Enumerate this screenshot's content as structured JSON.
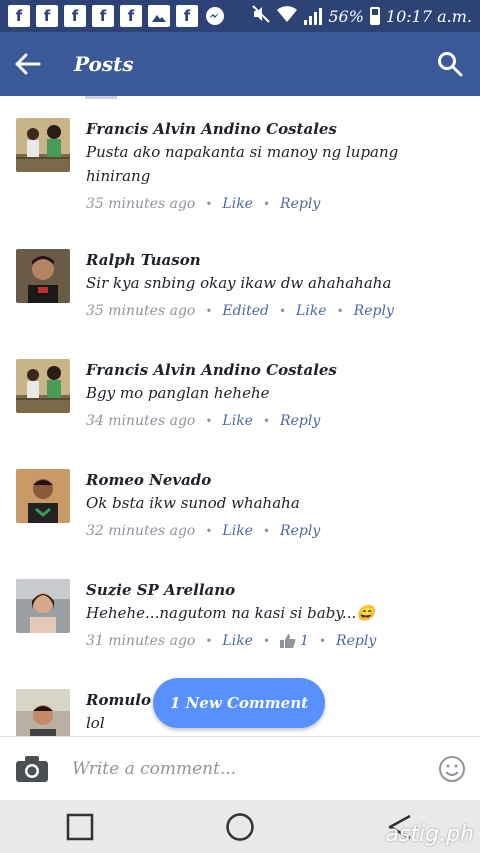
{
  "status_bar": {
    "battery": "56%",
    "time": "10:17 a.m."
  },
  "app_bar": {
    "title": "Posts"
  },
  "comments": [
    {
      "name": "Francis Alvin Andino Costales",
      "text": "Pusta ako napakanta si manoy ng lupang hinirang",
      "time": "35 minutes ago",
      "actions": [
        "Like",
        "Reply"
      ]
    },
    {
      "name": "Ralph Tuason",
      "text": "Sir kya snbing okay ikaw dw  ahahahaha",
      "time": "35 minutes ago",
      "edited": "Edited",
      "actions": [
        "Like",
        "Reply"
      ]
    },
    {
      "name": "Francis Alvin Andino Costales",
      "text": "Bgy mo panglan hehehe",
      "time": "34 minutes ago",
      "actions": [
        "Like",
        "Reply"
      ]
    },
    {
      "name": "Romeo Nevado",
      "text": "Ok bsta ikw sunod whahaha",
      "time": "32 minutes ago",
      "actions": [
        "Like",
        "Reply"
      ]
    },
    {
      "name": "Suzie SP Arellano",
      "text": "Hehehe...nagutom na kasi si baby...😄",
      "time": "31 minutes ago",
      "like_count": "1",
      "actions": [
        "Like",
        "Reply"
      ]
    },
    {
      "name": "Romulo",
      "text": "lol"
    }
  ],
  "new_comment_pill": "1 New Comment",
  "composer": {
    "placeholder": "Write a comment..."
  },
  "watermark": "astig.ph",
  "colors": {
    "status_bar": "#2d4375",
    "app_bar": "#3b5998",
    "link": "#4b69a6",
    "pill": "#5890ff"
  }
}
